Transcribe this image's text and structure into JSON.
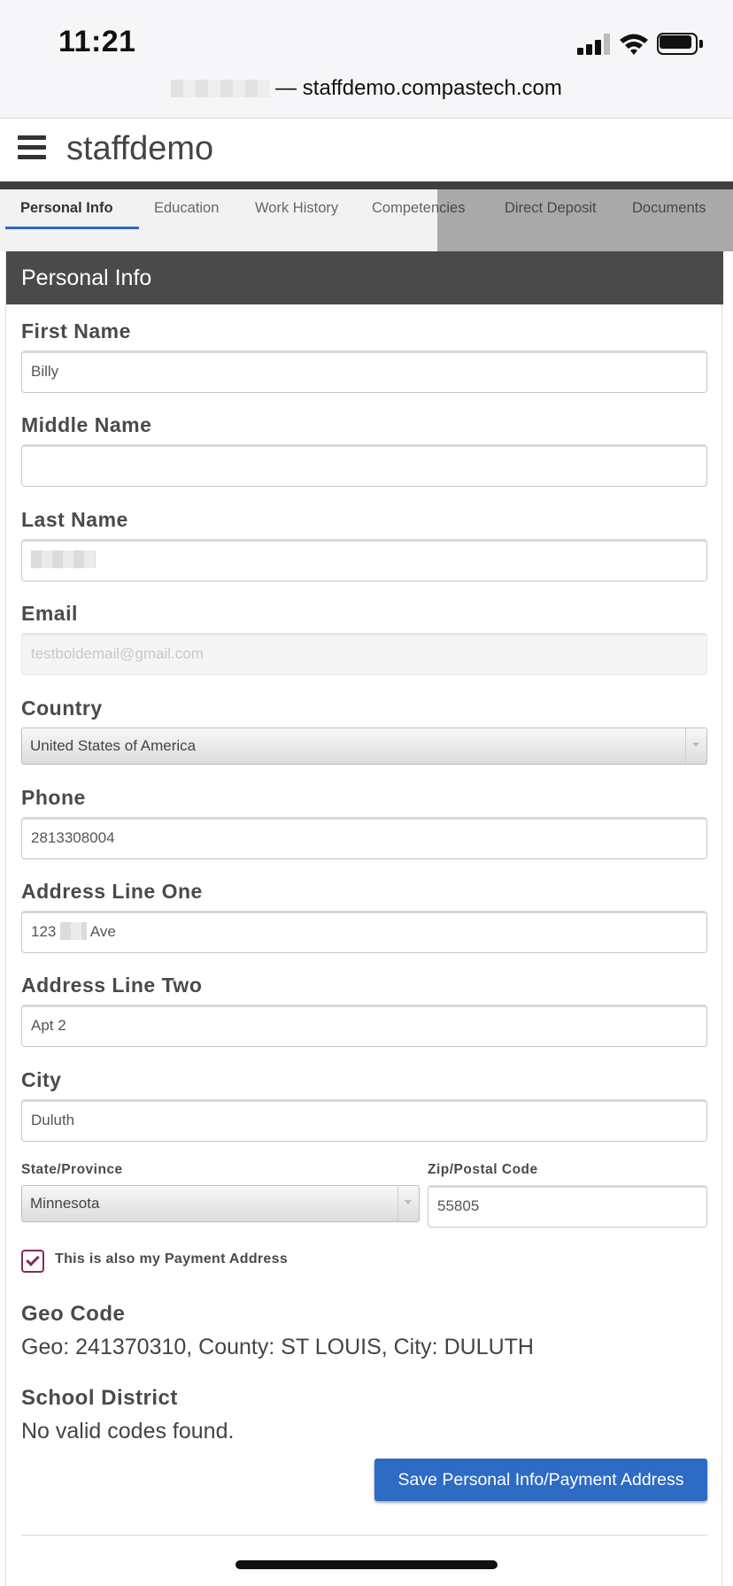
{
  "status_bar": {
    "time": "11:21"
  },
  "browser": {
    "url": "— staffdemo.compastech.com"
  },
  "app": {
    "title": "staffdemo"
  },
  "tabs": [
    {
      "label": "Personal Info",
      "active": true
    },
    {
      "label": "Education"
    },
    {
      "label": "Work History"
    },
    {
      "label": "Competencies"
    },
    {
      "label": "Direct Deposit"
    },
    {
      "label": "Documents"
    }
  ],
  "panel": {
    "title": "Personal Info"
  },
  "form": {
    "first_name": {
      "label": "First Name",
      "value": "Billy"
    },
    "middle_name": {
      "label": "Middle Name",
      "value": ""
    },
    "last_name": {
      "label": "Last Name",
      "value": ""
    },
    "email": {
      "label": "Email",
      "placeholder": "testboldemail@gmail.com"
    },
    "country": {
      "label": "Country",
      "value": "United States of America"
    },
    "phone": {
      "label": "Phone",
      "value": "2813308004"
    },
    "address_one": {
      "label": "Address Line One",
      "value_prefix": "123 ",
      "value_suffix": " Ave"
    },
    "address_two": {
      "label": "Address Line Two",
      "value": "Apt 2"
    },
    "city": {
      "label": "City",
      "value": "Duluth"
    },
    "state": {
      "label": "State/Province",
      "value": "Minnesota"
    },
    "zip": {
      "label": "Zip/Postal Code",
      "value": "55805"
    },
    "payment_checkbox": {
      "label": "This is also my Payment Address",
      "checked": true
    }
  },
  "geo": {
    "heading": "Geo Code",
    "value": "Geo: 241370310, County: ST LOUIS, City: DULUTH"
  },
  "school": {
    "heading": "School District",
    "value": "No valid codes found."
  },
  "actions": {
    "save_label": "Save Personal Info/Payment Address"
  },
  "colors": {
    "accent": "#2d6bc4",
    "header": "#4a4a4a",
    "checkbox": "#8a2a55"
  }
}
